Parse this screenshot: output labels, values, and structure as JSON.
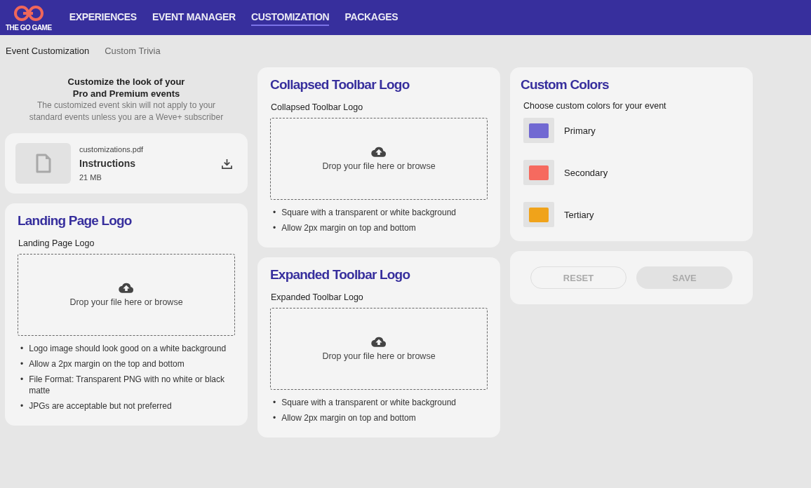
{
  "brand": {
    "name": "THE GO GAME"
  },
  "nav": [
    {
      "label": "EXPERIENCES",
      "selected": false
    },
    {
      "label": "EVENT MANAGER",
      "selected": false
    },
    {
      "label": "CUSTOMIZATION",
      "selected": true
    },
    {
      "label": "PACKAGES",
      "selected": false
    }
  ],
  "subnav": [
    {
      "label": "Event Customization",
      "selected": true
    },
    {
      "label": "Custom Trivia",
      "selected": false
    }
  ],
  "intro": {
    "title_lines": [
      "Customize the look of your",
      "Pro and Premium events"
    ],
    "note": "The customized event skin will not apply to your standard events unless you are a Weve+ subscriber"
  },
  "attachment": {
    "filename": "customizations.pdf",
    "title": "Instructions",
    "size": "21 MB"
  },
  "uploads": [
    {
      "title": "Landing Page Logo",
      "field_label": "Landing Page Logo",
      "dropzone": "Drop your file here or browse",
      "bullet": "•",
      "tips": [
        "Logo image should look good on a white background",
        "Allow a 2px margin on the top and bottom",
        "File Format: Transparent PNG with no white or black matte",
        "JPGs are acceptable but not preferred"
      ]
    },
    {
      "title": "Collapsed Toolbar Logo",
      "field_label": "Collapsed Toolbar Logo",
      "dropzone": "Drop your file here or browse",
      "bullet": "•",
      "tips": [
        "Square with a transparent or white background",
        "Allow 2px margin on top and bottom"
      ]
    },
    {
      "title": "Expanded Toolbar Logo",
      "field_label": "Expanded Toolbar Logo",
      "dropzone": "Drop your file here or browse",
      "bullet": "•",
      "tips": [
        "Square with a transparent or white background",
        "Allow 2px margin on top and bottom"
      ]
    }
  ],
  "colors": {
    "title": "Custom Colors",
    "subtitle": "Choose custom colors for your event",
    "items": [
      {
        "label": "Primary",
        "color": "#7169d2"
      },
      {
        "label": "Secondary",
        "color": "#f66a5f"
      },
      {
        "label": "Tertiary",
        "color": "#f0a31a"
      }
    ]
  },
  "actions": [
    {
      "label": "RESET",
      "kind": "outline",
      "disabled": true
    },
    {
      "label": "SAVE",
      "kind": "filled",
      "disabled": true
    }
  ]
}
